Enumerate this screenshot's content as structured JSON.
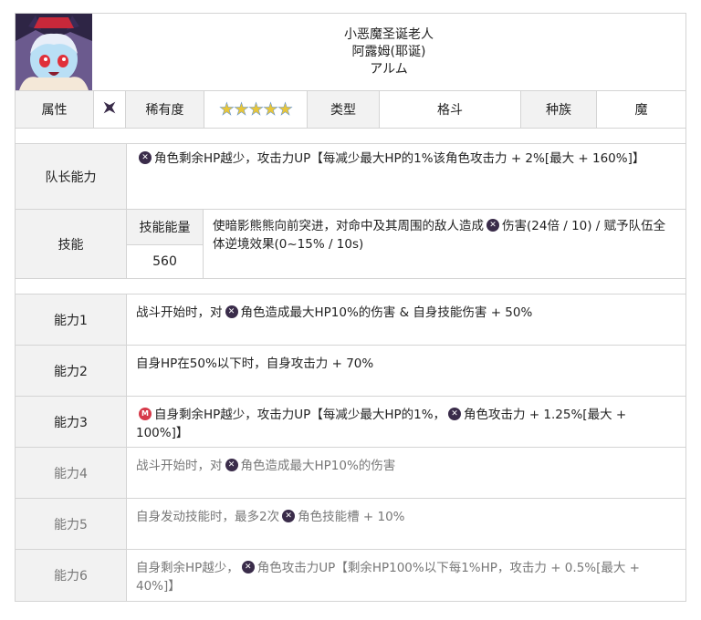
{
  "header": {
    "name_cn": "小恶魔圣诞老人",
    "name_cn2": "阿露姆(耶诞)",
    "name_jp": "アルム"
  },
  "attributes": {
    "attr_label": "属性",
    "rarity_label": "稀有度",
    "rarity_stars": "★★★★★",
    "type_label": "类型",
    "type_value": "格斗",
    "race_label": "种族",
    "race_value": "魔"
  },
  "leader": {
    "label": "队长能力",
    "text": "角色剩余HP越少，攻击力UP【每减少最大HP的1%该角色攻击力 + 2%[最大 + 160%]】"
  },
  "skill": {
    "label": "技能",
    "energy_label": "技能能量",
    "energy_value": "560",
    "text_a": "使暗影熊熊向前突进，对命中及其周围的敌人造成",
    "text_b": "伤害(24倍 / 10) / 赋予队伍全体逆境效果(0~15% / 10s)"
  },
  "abilities": [
    {
      "label": "能力1",
      "pre": "战斗开始时，对",
      "post": "角色造成最大HP10%的伤害 & 自身技能伤害 + 50%"
    },
    {
      "label": "能力2",
      "text": "自身HP在50%以下时，自身攻击力 + 70%"
    },
    {
      "label": "能力3",
      "pre": "自身剩余HP越少，攻击力UP【每减少最大HP的1%，",
      "post": "角色攻击力 + 1.25%[最大 + 100%]】"
    },
    {
      "label": "能力4",
      "pre": "战斗开始时，对",
      "post": "角色造成最大HP10%的伤害"
    },
    {
      "label": "能力5",
      "pre": "自身发动技能时，最多2次",
      "post": "角色技能槽 + 10%"
    },
    {
      "label": "能力6",
      "pre": "自身剩余HP越少，",
      "post": "角色攻击力UP【剩余HP100%以下每1%HP，攻击力 + 0.5%[最大 + 40%]】"
    }
  ],
  "colors": {
    "border": "#d4d4d4",
    "label_bg": "#f2f2f2",
    "dark_icon": "#3a2c4a",
    "red_icon": "#d63a4a"
  }
}
